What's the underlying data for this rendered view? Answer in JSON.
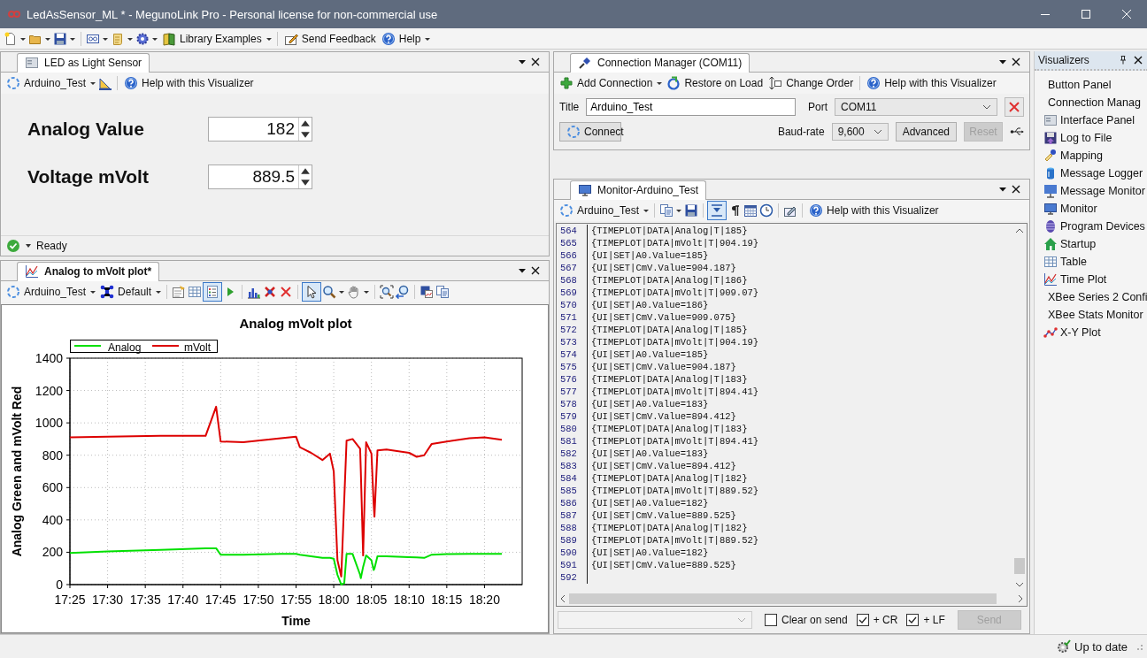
{
  "window": {
    "title": "LedAsSensor_ML * - MegunoLink Pro - Personal license for non-commercial use"
  },
  "main_toolbar": {
    "library_examples": "Library Examples",
    "send_feedback": "Send Feedback",
    "help": "Help"
  },
  "interface_panel": {
    "tab": "LED as Light Sensor",
    "connection": "Arduino_Test",
    "help": "Help with this Visualizer",
    "controls": [
      {
        "label": "Analog Value",
        "value": "182"
      },
      {
        "label": "Voltage mVolt",
        "value": "889.5"
      }
    ],
    "status": "Ready"
  },
  "plot_panel": {
    "tab": "Analog to mVolt plot*",
    "connection": "Arduino_Test",
    "style": "Default",
    "legend_on": true,
    "pointer_selected": true,
    "chart_data": {
      "type": "line",
      "title": "Analog mVolt plot",
      "xlabel": "Time",
      "ylabel": "Analog Green and mVolt Red",
      "x": [
        1045,
        1050,
        1057,
        1063,
        1064.4,
        1065,
        1068,
        1073,
        1075,
        1075.5,
        1077,
        1078.5,
        1079.5,
        1080,
        1080.5,
        1081,
        1081.4,
        1081.7,
        1082.5,
        1083.5,
        1083.6,
        1083.9,
        1084.3,
        1085,
        1085.3,
        1085.4,
        1085.8,
        1087,
        1090,
        1091,
        1092,
        1093,
        1095,
        1098,
        1100,
        1102.3
      ],
      "series": [
        {
          "name": "Analog",
          "color": "#00e000",
          "values": [
            195,
            205,
            215,
            225,
            225,
            185,
            185,
            190,
            190,
            185,
            175,
            165,
            165,
            160,
            60,
            0,
            10,
            190,
            190,
            60,
            40,
            110,
            180,
            150,
            90,
            100,
            175,
            175,
            170,
            168,
            165,
            185,
            188,
            190,
            190,
            190
          ]
        },
        {
          "name": "mVolt",
          "color": "#dd0000",
          "values": [
            910,
            915,
            920,
            920,
            1100,
            885,
            880,
            905,
            915,
            850,
            815,
            770,
            810,
            700,
            150,
            50,
            530,
            890,
            900,
            840,
            700,
            180,
            880,
            810,
            500,
            420,
            830,
            835,
            815,
            790,
            800,
            870,
            885,
            905,
            910,
            895
          ]
        }
      ],
      "xlim": [
        1045,
        1105
      ],
      "ylim": [
        0,
        1400
      ],
      "grid": true,
      "legend": "top left",
      "xticks": [
        {
          "value": 1045,
          "label": "17:25"
        },
        {
          "value": 1050,
          "label": "17:30"
        },
        {
          "value": 1055,
          "label": "17:35"
        },
        {
          "value": 1060,
          "label": "17:40"
        },
        {
          "value": 1065,
          "label": "17:45"
        },
        {
          "value": 1070,
          "label": "17:50"
        },
        {
          "value": 1075,
          "label": "17:55"
        },
        {
          "value": 1080,
          "label": "18:00"
        },
        {
          "value": 1085,
          "label": "18:05"
        },
        {
          "value": 1090,
          "label": "18:10"
        },
        {
          "value": 1095,
          "label": "18:15"
        },
        {
          "value": 1100,
          "label": "18:20"
        }
      ],
      "yticks": [
        0,
        200,
        400,
        600,
        800,
        1000,
        1200,
        1400
      ]
    }
  },
  "connection_manager": {
    "tab": "Connection Manager (COM11)",
    "add_connection": "Add Connection",
    "restore_on_load": "Restore on Load",
    "change_order": "Change Order",
    "help": "Help with this Visualizer",
    "title_label": "Title",
    "title_value": "Arduino_Test",
    "port_label": "Port",
    "port_value": "COM11",
    "connect": "Connect",
    "baud_label": "Baud-rate",
    "baud_value": "9,600",
    "advanced": {
      "label": "Advanced",
      "disabled": false
    },
    "reset": {
      "label": "Reset",
      "disabled": true
    }
  },
  "monitor": {
    "tab": "Monitor-Arduino_Test",
    "connection": "Arduino_Test",
    "help": "Help with this Visualizer",
    "autoscroll_on": true,
    "lines": [
      {
        "number": "564",
        "text": "{TIMEPLOT|DATA|Analog|T|185}"
      },
      {
        "number": "565",
        "text": "{TIMEPLOT|DATA|mVolt|T|904.19}"
      },
      {
        "number": "566",
        "text": "{UI|SET|A0.Value=185}"
      },
      {
        "number": "567",
        "text": "{UI|SET|CmV.Value=904.187}"
      },
      {
        "number": "568",
        "text": "{TIMEPLOT|DATA|Analog|T|186}"
      },
      {
        "number": "569",
        "text": "{TIMEPLOT|DATA|mVolt|T|909.07}"
      },
      {
        "number": "570",
        "text": "{UI|SET|A0.Value=186}"
      },
      {
        "number": "571",
        "text": "{UI|SET|CmV.Value=909.075}"
      },
      {
        "number": "572",
        "text": "{TIMEPLOT|DATA|Analog|T|185}"
      },
      {
        "number": "573",
        "text": "{TIMEPLOT|DATA|mVolt|T|904.19}"
      },
      {
        "number": "574",
        "text": "{UI|SET|A0.Value=185}"
      },
      {
        "number": "575",
        "text": "{UI|SET|CmV.Value=904.187}"
      },
      {
        "number": "576",
        "text": "{TIMEPLOT|DATA|Analog|T|183}"
      },
      {
        "number": "577",
        "text": "{TIMEPLOT|DATA|mVolt|T|894.41}"
      },
      {
        "number": "578",
        "text": "{UI|SET|A0.Value=183}"
      },
      {
        "number": "579",
        "text": "{UI|SET|CmV.Value=894.412}"
      },
      {
        "number": "580",
        "text": "{TIMEPLOT|DATA|Analog|T|183}"
      },
      {
        "number": "581",
        "text": "{TIMEPLOT|DATA|mVolt|T|894.41}"
      },
      {
        "number": "582",
        "text": "{UI|SET|A0.Value=183}"
      },
      {
        "number": "583",
        "text": "{UI|SET|CmV.Value=894.412}"
      },
      {
        "number": "584",
        "text": "{TIMEPLOT|DATA|Analog|T|182}"
      },
      {
        "number": "585",
        "text": "{TIMEPLOT|DATA|mVolt|T|889.52}"
      },
      {
        "number": "586",
        "text": "{UI|SET|A0.Value=182}"
      },
      {
        "number": "587",
        "text": "{UI|SET|CmV.Value=889.525}"
      },
      {
        "number": "588",
        "text": "{TIMEPLOT|DATA|Analog|T|182}"
      },
      {
        "number": "589",
        "text": "{TIMEPLOT|DATA|mVolt|T|889.52}"
      },
      {
        "number": "590",
        "text": "{UI|SET|A0.Value=182}"
      },
      {
        "number": "591",
        "text": "{UI|SET|CmV.Value=889.525}"
      },
      {
        "number": "592"
      }
    ],
    "options": [
      {
        "label": "Clear on send",
        "checked": false
      },
      {
        "label": "+ CR",
        "checked": true
      },
      {
        "label": "+ LF",
        "checked": true
      }
    ],
    "send": {
      "label": "Send",
      "disabled": true
    }
  },
  "visualizers": {
    "title": "Visualizers",
    "items": [
      {
        "label": "Button Panel"
      },
      {
        "label": "Connection Manag"
      },
      {
        "label": "Interface Panel"
      },
      {
        "label": "Log to File"
      },
      {
        "label": "Mapping"
      },
      {
        "label": "Message Logger"
      },
      {
        "label": "Message Monitor"
      },
      {
        "label": "Monitor"
      },
      {
        "label": "Program Devices"
      },
      {
        "label": "Startup"
      },
      {
        "label": "Table"
      },
      {
        "label": "Time Plot"
      },
      {
        "label": "XBee Series 2 Confi"
      },
      {
        "label": "XBee Stats Monitor"
      },
      {
        "label": "X-Y Plot"
      }
    ]
  },
  "status_bar": {
    "text": "Up to date"
  }
}
